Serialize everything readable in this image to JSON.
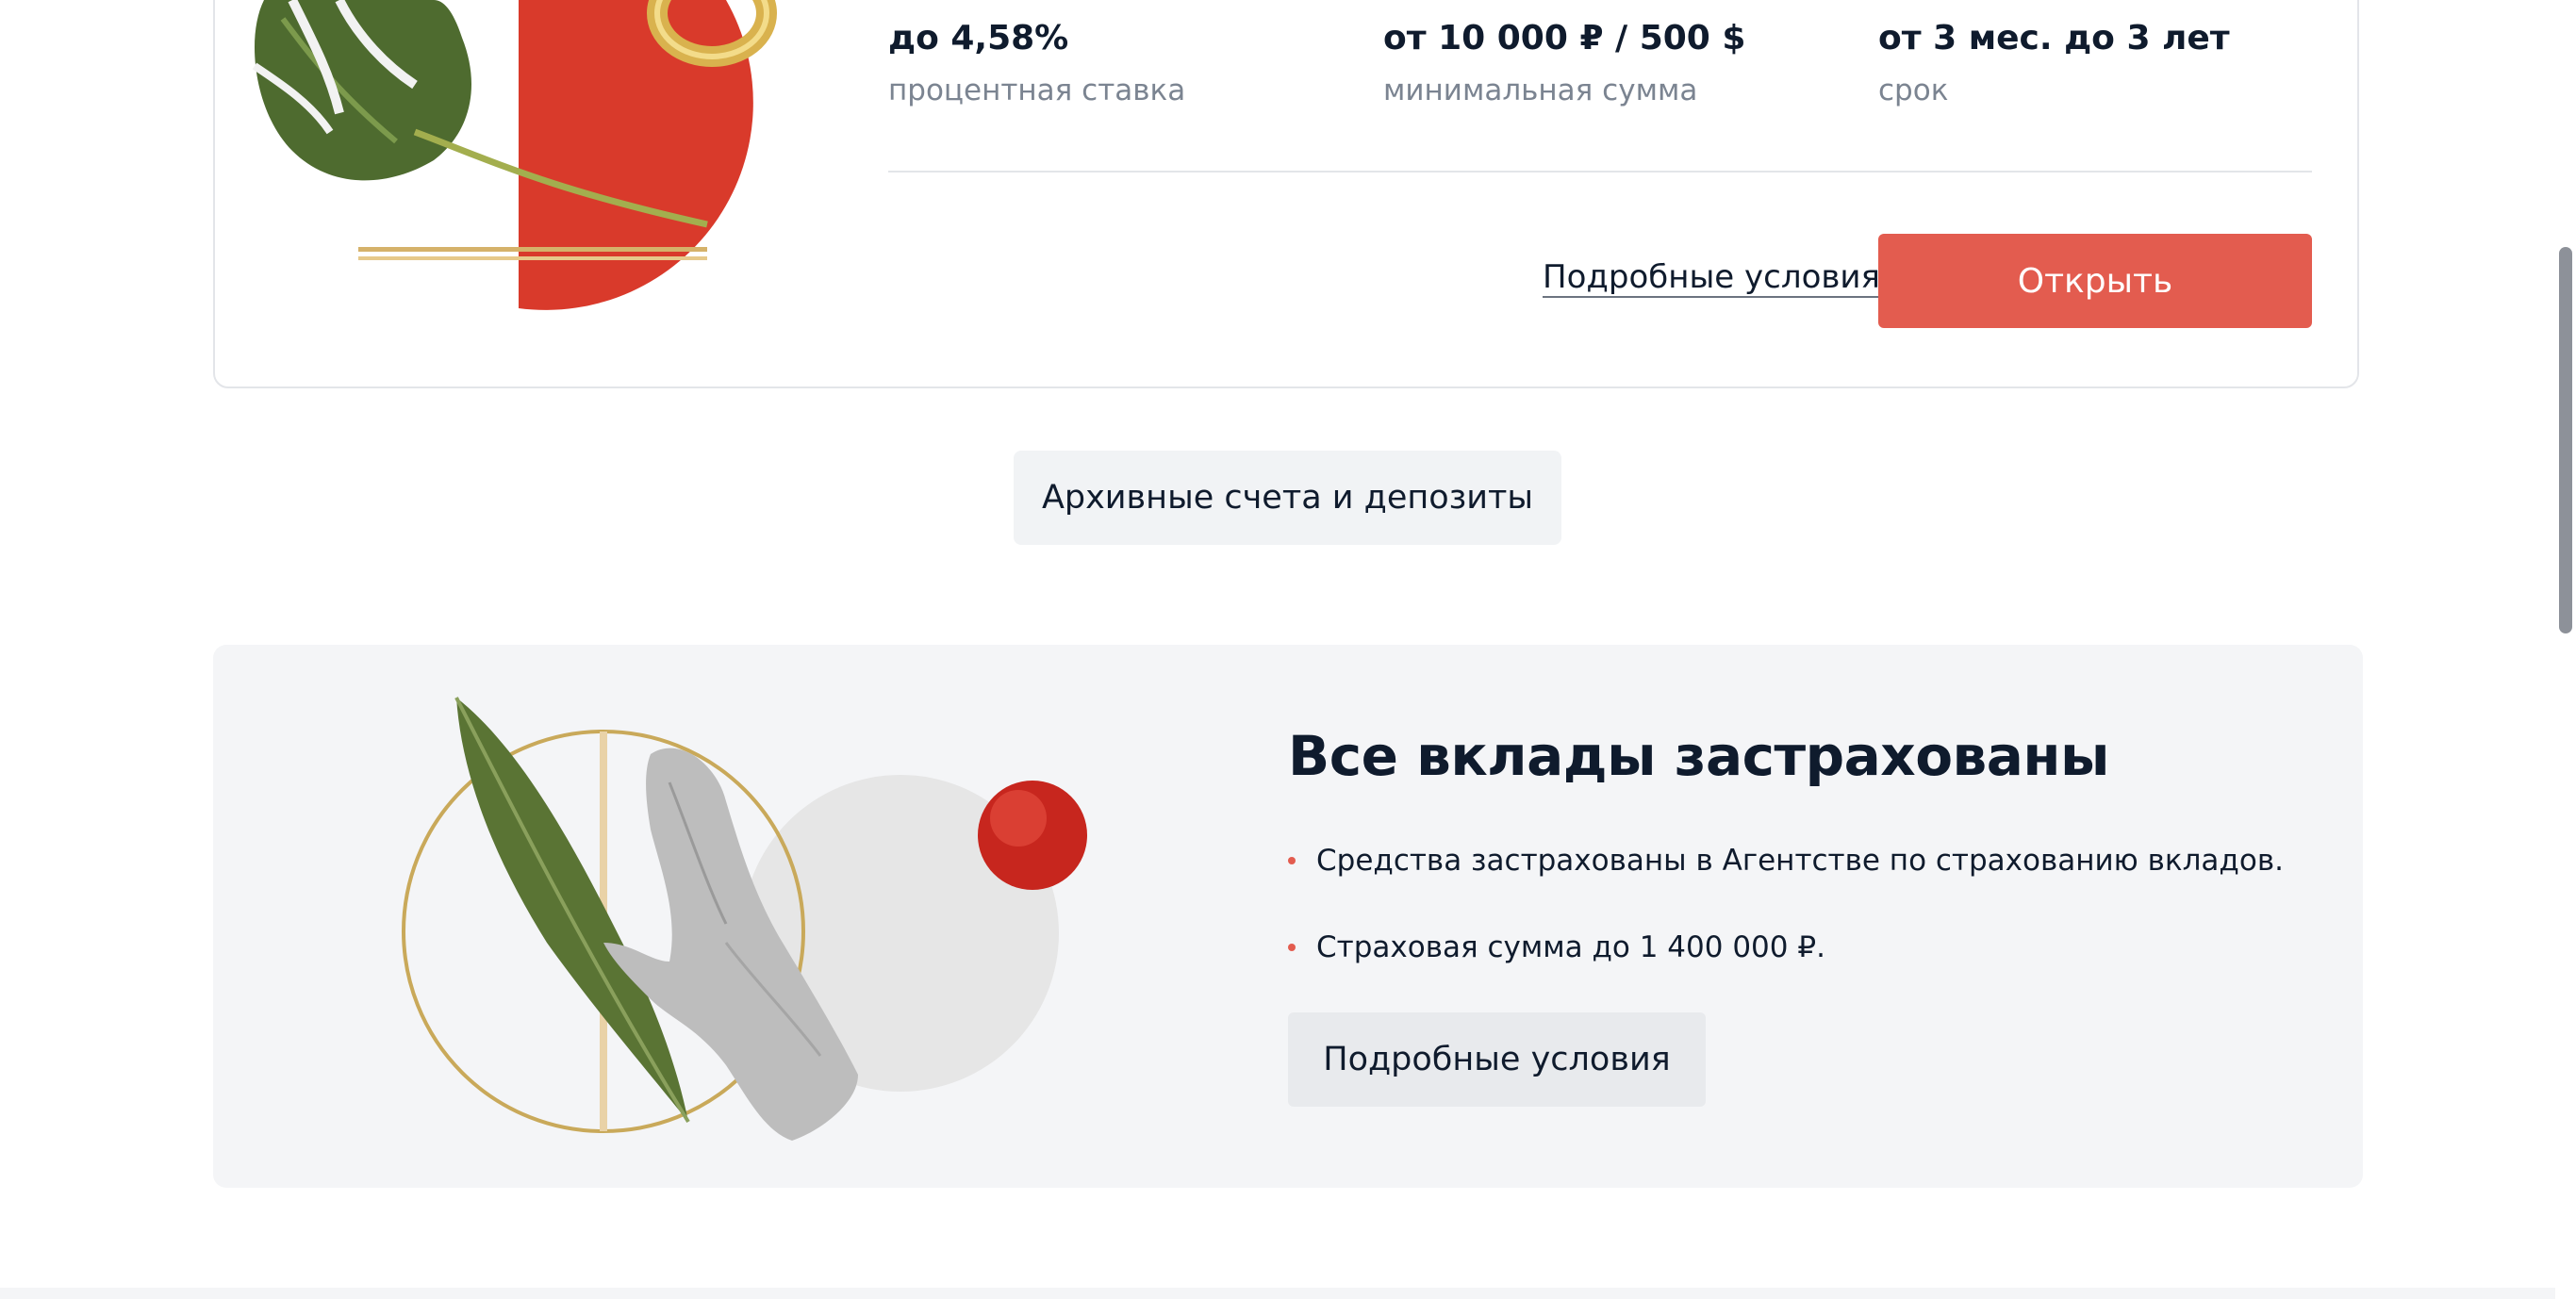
{
  "deposit_card": {
    "stats": [
      {
        "value": "до 4,58%",
        "caption": "процентная ставка"
      },
      {
        "value": "от 10 000 ₽ / 500 $",
        "caption": "минимальная сумма"
      },
      {
        "value": "от 3 мес. до 3 лет",
        "caption": "срок"
      }
    ],
    "details_link": "Подробные условия",
    "open_button": "Открыть"
  },
  "archive_button": "Архивные счета и депозиты",
  "insurance": {
    "title": "Все вклады застрахованы",
    "bullets": [
      "Средства застрахованы в Агентстве по страхованию вкладов.",
      "Страховая сумма до 1 400 000 ₽."
    ],
    "details_button": "Подробные условия"
  },
  "colors": {
    "accent": "#e35c4f",
    "text": "#0f1b2d",
    "muted": "#7b8491",
    "surface": "#f4f5f7"
  }
}
